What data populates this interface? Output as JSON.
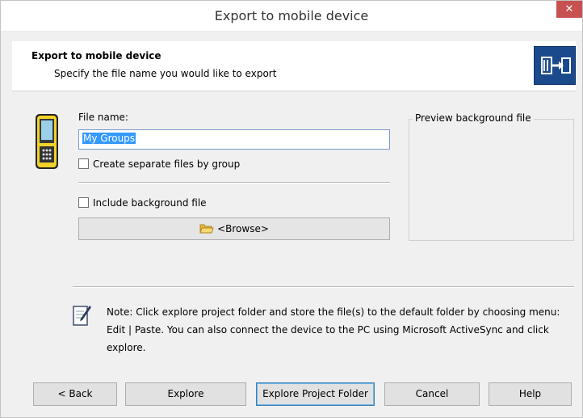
{
  "window": {
    "title": "Export to mobile device",
    "close_glyph": "✕"
  },
  "header": {
    "title": "Export to mobile device",
    "subtitle": "Specify the file name you would like to export",
    "icon": "export-device-icon"
  },
  "form": {
    "file_name_label": "File name:",
    "file_name_value": "My Groups",
    "separate_files_label": "Create separate files by group",
    "separate_files_checked": false,
    "include_background_label": "Include background file",
    "include_background_checked": false,
    "browse_label": "<Browse>",
    "preview_title": "Preview background file"
  },
  "note": {
    "text": "Note: Click explore project folder and store the file(s) to the default folder by choosing menu: Edit | Paste. You can also connect the device to the PC using Microsoft ActiveSync and click explore."
  },
  "buttons": {
    "back": "< Back",
    "explore": "Explore",
    "explore_project_folder": "Explore Project Folder",
    "cancel": "Cancel",
    "help": "Help"
  },
  "colors": {
    "close": "#c75050",
    "header_icon": "#1b4a8c",
    "selection": "#3399ff"
  }
}
